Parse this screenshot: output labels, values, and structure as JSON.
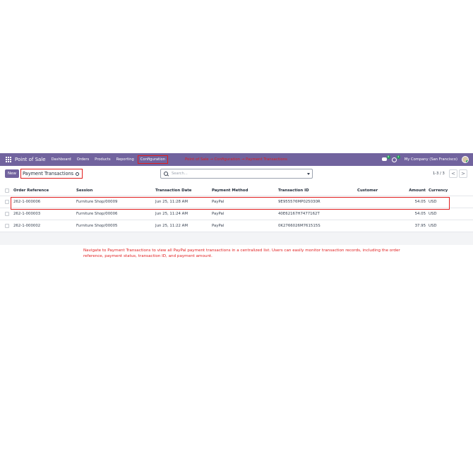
{
  "navbar": {
    "app_name": "Point of Sale",
    "menu": [
      "Dashboard",
      "Orders",
      "Products",
      "Reporting",
      "Configuration"
    ],
    "annotation_path": "Point of Sale → Configuration → Payment Transactions",
    "chat_badge": "8",
    "activity_badge": "4",
    "company": "My Company (San Francisco)"
  },
  "control": {
    "new_label": "New",
    "breadcrumb": "Payment Transactions",
    "search_placeholder": "Search...",
    "pager": "1-3 / 3",
    "prev": "<",
    "next": ">"
  },
  "table": {
    "headers": [
      "Order Reference",
      "Session",
      "Transaction Date",
      "Payment Method",
      "Transaction ID",
      "Customer",
      "Amount",
      "Currency"
    ],
    "rows": [
      {
        "ref": "262-1-000006",
        "session": "Furniture Shop/00009",
        "date": "Jun 25, 11:28 AM",
        "method": "PayPal",
        "tid": "9E955576MP025030R",
        "customer": "",
        "amount": "54.05",
        "currency": "USD"
      },
      {
        "ref": "262-1-000003",
        "session": "Furniture Shop/00006",
        "date": "Jun 25, 11:24 AM",
        "method": "PayPal",
        "tid": "40E62167H7477162T",
        "customer": "",
        "amount": "54.05",
        "currency": "USD"
      },
      {
        "ref": "262-1-000002",
        "session": "Furniture Shop/00005",
        "date": "Jun 25, 11:22 AM",
        "method": "PayPal",
        "tid": "0K2766026M761515S",
        "customer": "",
        "amount": "37.95",
        "currency": "USD"
      }
    ]
  },
  "annotation_text": "Navigate to Payment Transactions to view all PayPal payment transactions in a centralized list. Users can easily monitor transaction records, including the order reference, payment status, transaction ID, and payment amount.",
  "colors": {
    "navbar": "#71639e",
    "annotation": "#e11d1d"
  }
}
